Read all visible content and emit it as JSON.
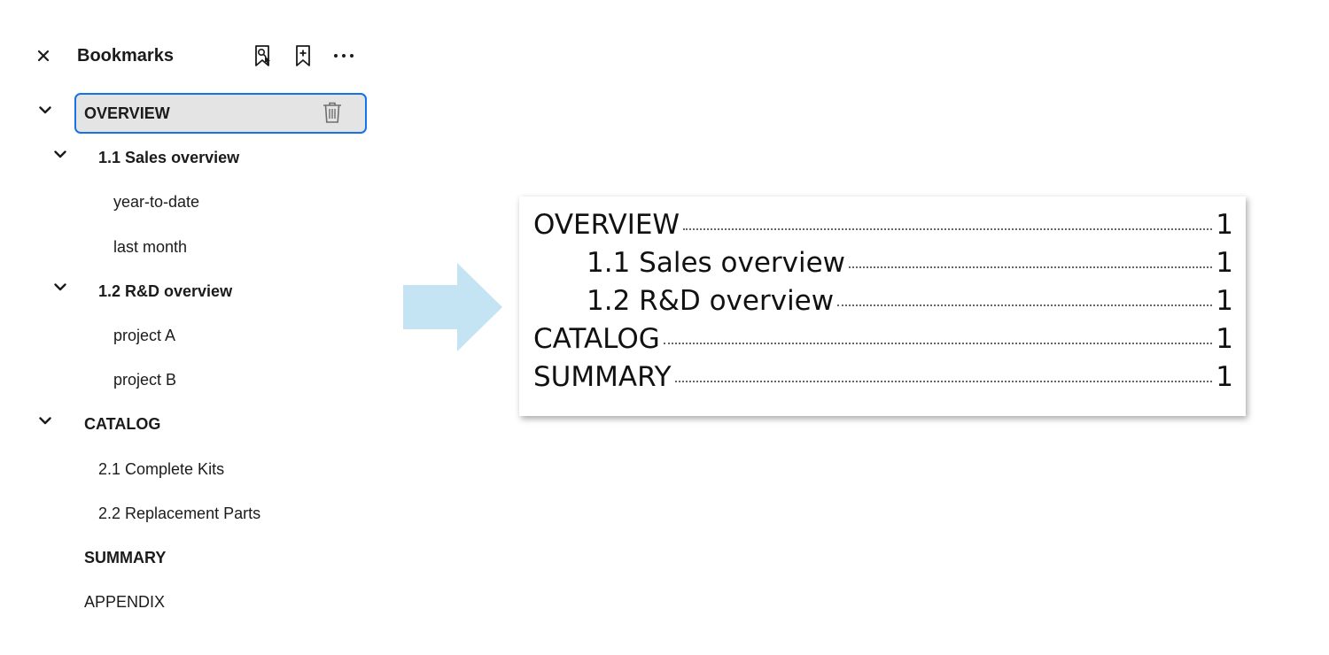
{
  "panel": {
    "title": "Bookmarks",
    "close_icon": "close-icon",
    "header_buttons": [
      "find-bookmark-icon",
      "add-bookmark-icon",
      "more-options-icon"
    ]
  },
  "tree": [
    {
      "label": "OVERVIEW",
      "level": 0,
      "bold": true,
      "expanded": true,
      "selected": true
    },
    {
      "label": "1.1 Sales overview",
      "level": 1,
      "bold": true,
      "expanded": true
    },
    {
      "label": "year-to-date",
      "level": 2
    },
    {
      "label": "last month",
      "level": 2
    },
    {
      "label": "1.2 R&D overview",
      "level": 1,
      "bold": true,
      "expanded": true
    },
    {
      "label": "project A",
      "level": 2
    },
    {
      "label": "project B",
      "level": 2
    },
    {
      "label": "CATALOG",
      "level": 0,
      "bold": true,
      "expanded": true
    },
    {
      "label": "2.1 Complete Kits",
      "level": 1
    },
    {
      "label": "2.2 Replacement Parts",
      "level": 1
    },
    {
      "label": "SUMMARY",
      "level": 0,
      "bold": true
    },
    {
      "label": "APPENDIX",
      "level": 0
    }
  ],
  "toc": [
    {
      "text": "OVERVIEW",
      "page": "1",
      "level": 0
    },
    {
      "text": "1.1 Sales overview",
      "page": "1",
      "level": 1
    },
    {
      "text": "1.2 R&D overview",
      "page": "1",
      "level": 1
    },
    {
      "text": "CATALOG",
      "page": "1",
      "level": 0
    },
    {
      "text": "SUMMARY",
      "page": "1",
      "level": 0
    }
  ],
  "colors": {
    "accent": "#1473e6",
    "selected_bg": "#e4e4e4",
    "arrow": "#c4e4f4"
  }
}
